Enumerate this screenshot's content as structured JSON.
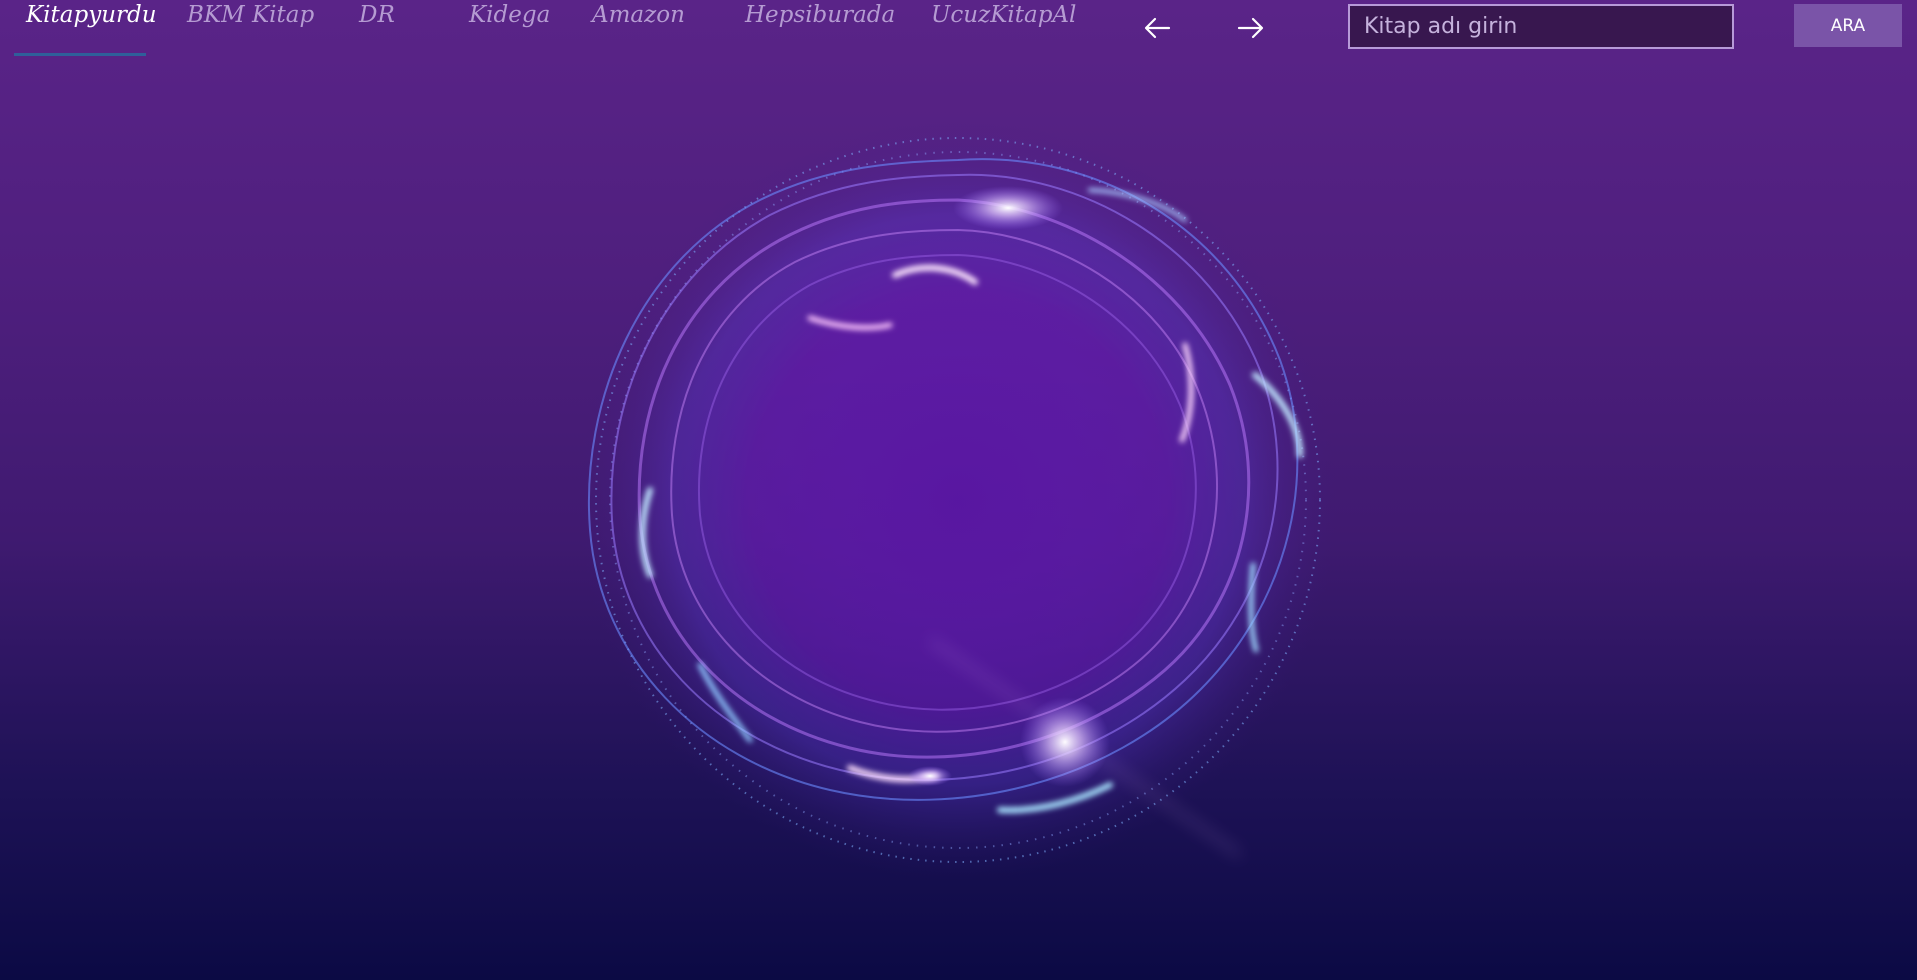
{
  "tabs": [
    {
      "label": "Kitapyurdu",
      "active": true
    },
    {
      "label": "BKM Kitap",
      "active": false
    },
    {
      "label": "DR",
      "active": false
    },
    {
      "label": "Kidega",
      "active": false
    },
    {
      "label": "Amazon",
      "active": false
    },
    {
      "label": "Hepsiburada",
      "active": false
    },
    {
      "label": "UcuzKitapAl",
      "active": false
    }
  ],
  "navigation": {
    "back_icon": "arrow-left-icon",
    "forward_icon": "arrow-right-icon"
  },
  "search": {
    "placeholder": "Kitap adı girin",
    "value": "",
    "button_label": "ARA"
  },
  "colors": {
    "active_tab_underline": "#2f5f9a",
    "search_button": "#7a54a8",
    "background_top": "#5a2488",
    "background_bottom": "#0b0a44"
  }
}
